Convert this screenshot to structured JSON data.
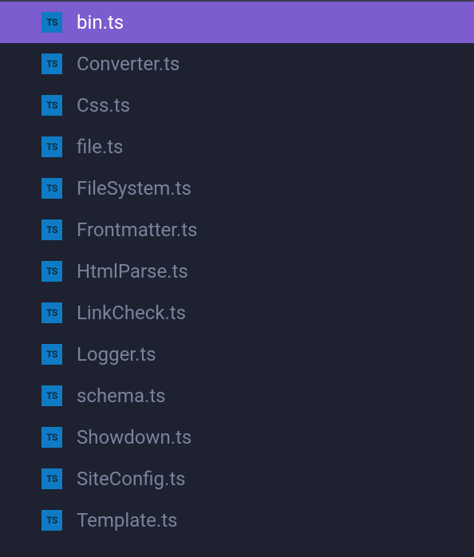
{
  "iconLabel": "TS",
  "files": [
    {
      "name": "bin.ts",
      "selected": true
    },
    {
      "name": "Converter.ts",
      "selected": false
    },
    {
      "name": "Css.ts",
      "selected": false
    },
    {
      "name": "file.ts",
      "selected": false
    },
    {
      "name": "FileSystem.ts",
      "selected": false
    },
    {
      "name": "Frontmatter.ts",
      "selected": false
    },
    {
      "name": "HtmlParse.ts",
      "selected": false
    },
    {
      "name": "LinkCheck.ts",
      "selected": false
    },
    {
      "name": "Logger.ts",
      "selected": false
    },
    {
      "name": "schema.ts",
      "selected": false
    },
    {
      "name": "Showdown.ts",
      "selected": false
    },
    {
      "name": "SiteConfig.ts",
      "selected": false
    },
    {
      "name": "Template.ts",
      "selected": false
    }
  ]
}
